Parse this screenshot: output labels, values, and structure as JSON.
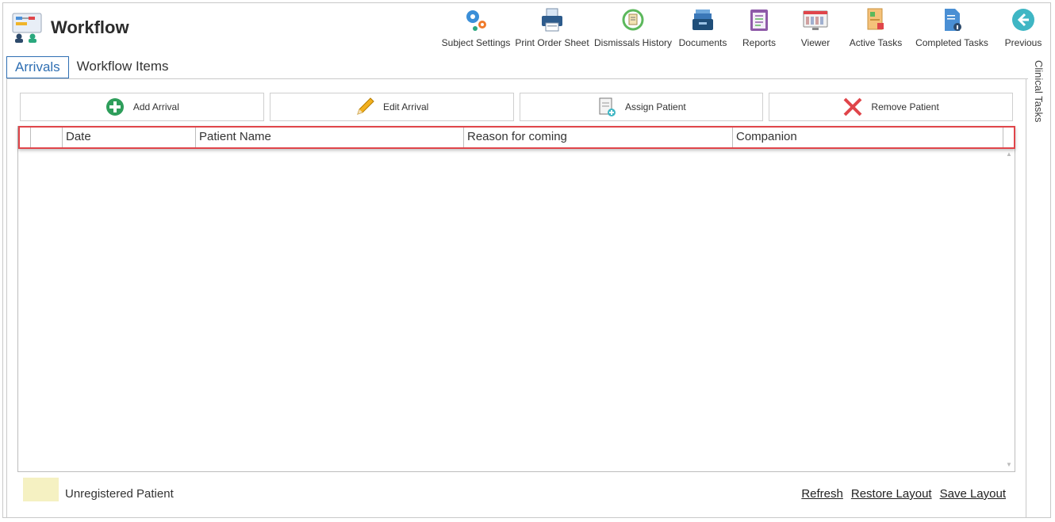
{
  "app": {
    "title": "Workflow",
    "logo_icon": "workflow-logo-icon"
  },
  "toolbar": [
    {
      "label": "Subject Settings",
      "icon": "gears-icon"
    },
    {
      "label": "Print Order Sheet",
      "icon": "printer-icon"
    },
    {
      "label": "Dismissals History",
      "icon": "history-icon"
    },
    {
      "label": "Documents",
      "icon": "documents-tray-icon"
    },
    {
      "label": "Reports",
      "icon": "clipboard-icon"
    },
    {
      "label": "Viewer",
      "icon": "viewer-icon"
    },
    {
      "label": "Active Tasks",
      "icon": "active-tasks-icon"
    },
    {
      "label": "Completed Tasks",
      "icon": "completed-tasks-icon"
    },
    {
      "label": "Previous",
      "icon": "back-arrow-icon"
    }
  ],
  "tabs": [
    {
      "label": "Arrivals",
      "active": true
    },
    {
      "label": "Workflow Items",
      "active": false
    }
  ],
  "side_tab": {
    "label": "Clinical Tasks"
  },
  "actions": [
    {
      "label": "Add Arrival",
      "icon": "add-circle-icon"
    },
    {
      "label": "Edit Arrival",
      "icon": "pencil-icon"
    },
    {
      "label": "Assign Patient",
      "icon": "assign-document-icon"
    },
    {
      "label": "Remove Patient",
      "icon": "remove-x-icon"
    }
  ],
  "grid": {
    "columns": [
      "",
      "",
      "Date",
      "Patient Name",
      "Reason for coming",
      "Companion"
    ],
    "rows": []
  },
  "legend": {
    "label": "Unregistered Patient",
    "color": "#f5f1c2"
  },
  "footer_links": [
    "Refresh",
    "Restore Layout",
    "Save Layout"
  ]
}
